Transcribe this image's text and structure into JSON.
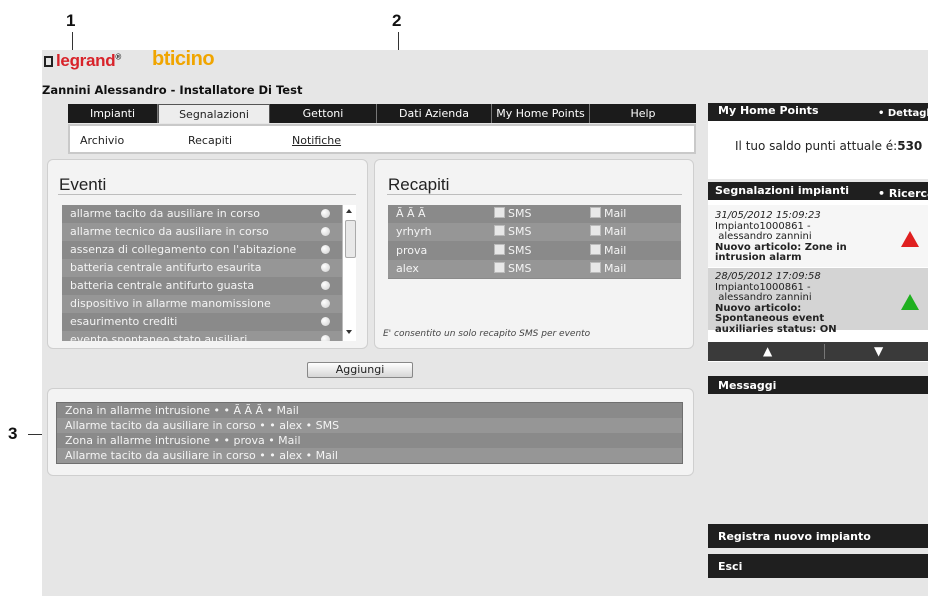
{
  "callouts": [
    "1",
    "2",
    "3"
  ],
  "brand": {
    "legrand": "legrand",
    "legrand_mark": "®",
    "bticino": "bticino"
  },
  "user_title": "Zannini Alessandro - Installatore Di Test",
  "nav": {
    "tabs": [
      "Impianti",
      "Segnalazioni",
      "Gettoni",
      "Dati Azienda",
      "My Home Points",
      "Help"
    ],
    "active": "Segnalazioni"
  },
  "subnav": {
    "items": [
      "Archivio",
      "Recapiti",
      "Notifiche"
    ],
    "underlined": "Notifiche"
  },
  "eventi": {
    "title": "Eventi",
    "items": [
      "allarme tacito da ausiliare in corso",
      "allarme tecnico da ausiliare in corso",
      "assenza di collegamento con l'abitazione",
      "batteria centrale antifurto esaurita",
      "batteria centrale antifurto guasta",
      "dispositivo in allarme manomissione",
      "esaurimento crediti",
      "evento spontaneo stato ausiliari"
    ]
  },
  "recapiti": {
    "title": "Recapiti",
    "rows": [
      {
        "name": "Ã Ã Ã",
        "sms": "SMS",
        "mail": "Mail"
      },
      {
        "name": "yrhyrh",
        "sms": "SMS",
        "mail": "Mail"
      },
      {
        "name": "prova",
        "sms": "SMS",
        "mail": "Mail"
      },
      {
        "name": "alex",
        "sms": "SMS",
        "mail": "Mail"
      }
    ],
    "note": "E' consentito un solo recapito SMS per evento"
  },
  "aggiungi_label": "Aggiungi",
  "notifiche": [
    "Zona in allarme intrusione • • Ã Ã Ã  • Mail",
    "Allarme tacito da ausiliare in corso • • alex • SMS",
    "Zona in allarme intrusione • • prova • Mail",
    "Allarme tacito da ausiliare in corso • • alex • Mail"
  ],
  "side": {
    "points": {
      "title": "My Home Points",
      "link": "• Dettagli",
      "text": "Il tuo saldo punti attuale é:",
      "value": "530"
    },
    "segnalazioni": {
      "title": "Segnalazioni impianti",
      "link": "• Ricerca",
      "items": [
        {
          "date": "31/05/2012 15:09:23",
          "plant": "Impianto1000861 -",
          "owner": "alessandro zannini",
          "text": "Nuovo articolo: Zone in intrusion alarm",
          "status_color": "#e02020"
        },
        {
          "date": "28/05/2012 17:09:58",
          "plant": "Impianto1000861 -",
          "owner": "alessandro zannini",
          "text": "Nuovo articolo: Spontaneous event auxiliaries status: ON",
          "status_color": "#20b020"
        }
      ],
      "up": "▲",
      "down": "▼"
    },
    "messaggi": "Messaggi",
    "registra": "Registra nuovo impianto",
    "esci": "Esci"
  }
}
